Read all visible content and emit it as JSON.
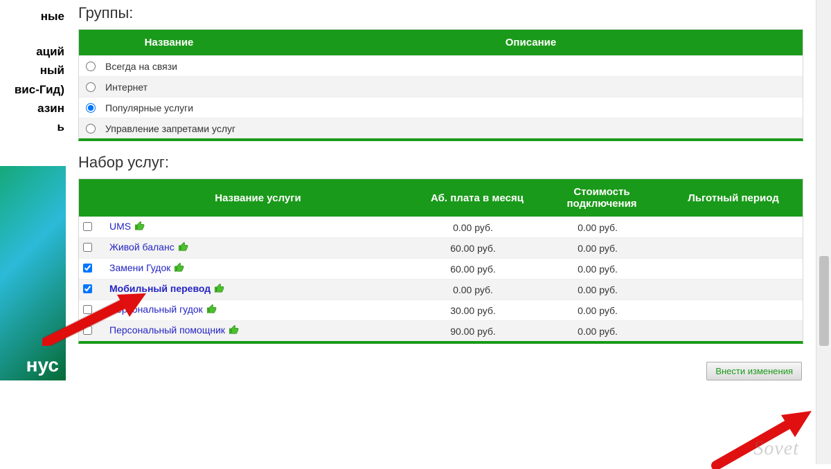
{
  "sidebar": {
    "links": [
      "ные",
      "аций",
      "ный",
      "вис-Гид)",
      "азин",
      "ь"
    ],
    "banner_text": "нус"
  },
  "sections": {
    "groups_title": "Группы:",
    "services_title": "Набор услуг:"
  },
  "groups": {
    "headers": {
      "name": "Название",
      "desc": "Описание"
    },
    "items": [
      {
        "label": "Всегда на связи",
        "selected": false
      },
      {
        "label": "Интернет",
        "selected": false
      },
      {
        "label": "Популярные услуги",
        "selected": true
      },
      {
        "label": "Управление запретами услуг",
        "selected": false
      }
    ]
  },
  "services": {
    "headers": {
      "name": "Название услуги",
      "fee": "Аб. плата в месяц",
      "cost": "Стоимость подключения",
      "grace": "Льготный период"
    },
    "items": [
      {
        "name": "UMS",
        "fee": "0.00 руб.",
        "cost": "0.00 руб.",
        "grace": "",
        "checked": false,
        "bold": false
      },
      {
        "name": "Живой баланс",
        "fee": "60.00 руб.",
        "cost": "0.00 руб.",
        "grace": "",
        "checked": false,
        "bold": false
      },
      {
        "name": "Замени Гудок",
        "fee": "60.00 руб.",
        "cost": "0.00 руб.",
        "grace": "",
        "checked": true,
        "bold": false
      },
      {
        "name": "Мобильный перевод",
        "fee": "0.00 руб.",
        "cost": "0.00 руб.",
        "grace": "",
        "checked": true,
        "bold": true
      },
      {
        "name": "Персональный гудок",
        "fee": "30.00 руб.",
        "cost": "0.00 руб.",
        "grace": "",
        "checked": false,
        "bold": false
      },
      {
        "name": "Персональный помощник",
        "fee": "90.00 руб.",
        "cost": "0.00 руб.",
        "grace": "",
        "checked": false,
        "bold": false
      }
    ]
  },
  "buttons": {
    "submit": "Внести изменения"
  },
  "watermark": "Sovet",
  "colors": {
    "accent": "#1a9a1a",
    "link": "#2424c5"
  }
}
